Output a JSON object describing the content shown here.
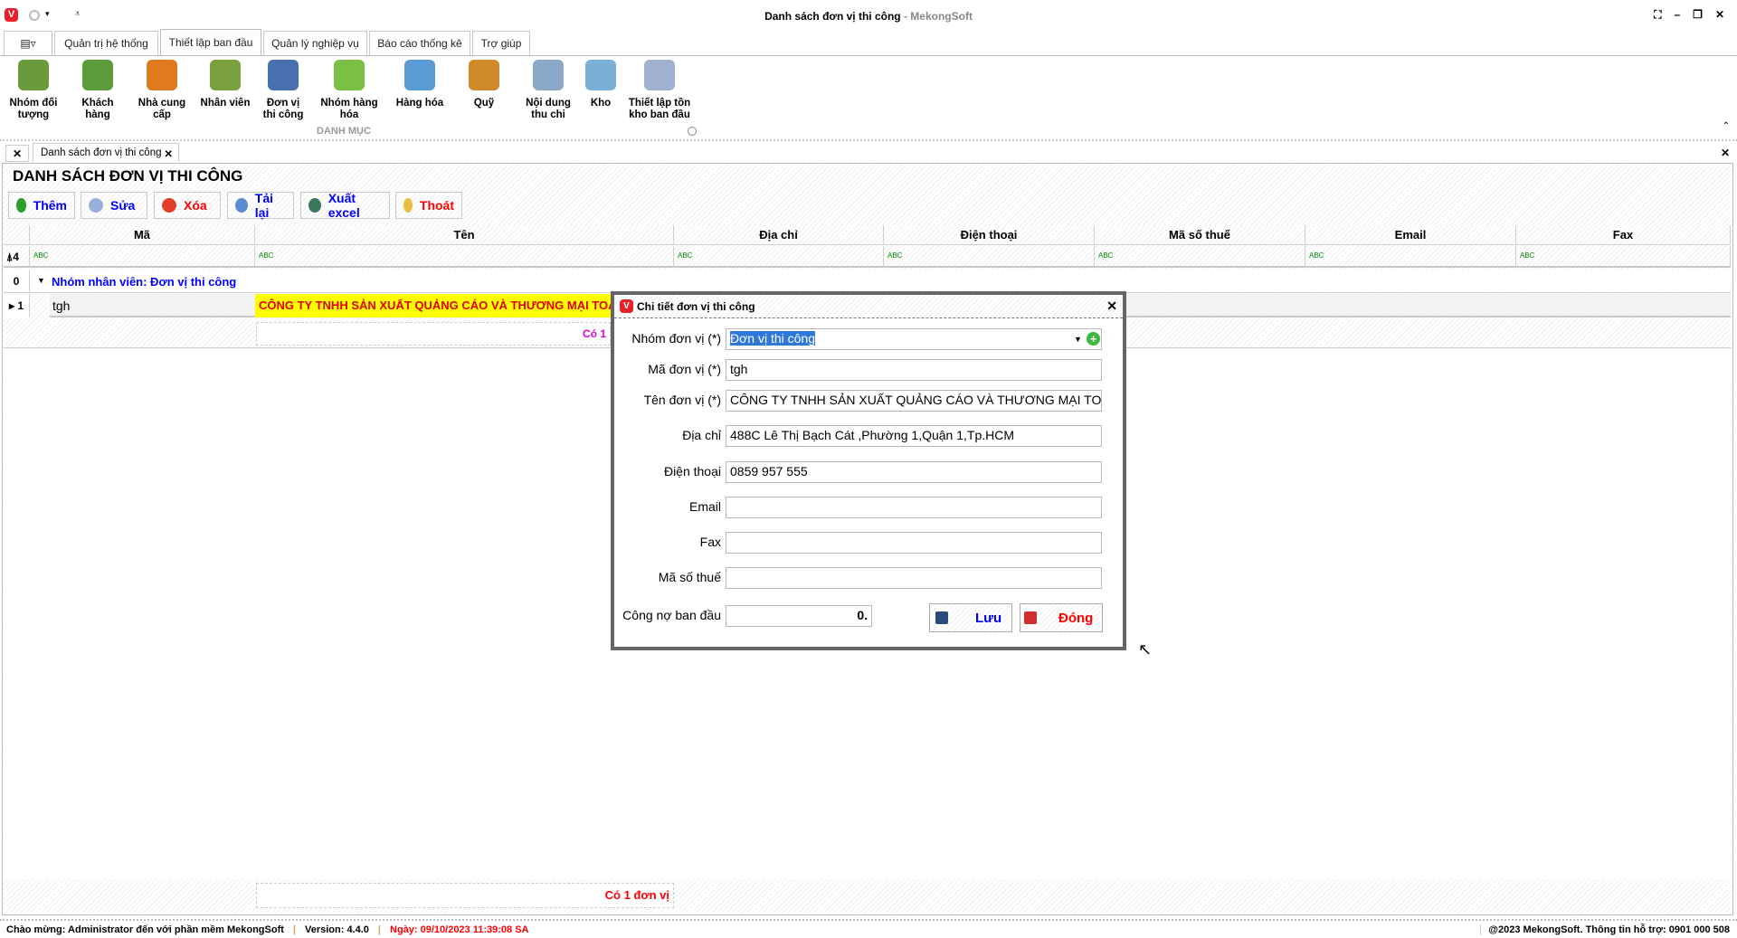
{
  "window": {
    "title": "Danh sách đơn vị thi công",
    "brand": " - MekongSoft"
  },
  "ribbon_tabs": [
    "Quản trị hệ thống",
    "Thiết lập ban đầu",
    "Quản lý nghiệp vụ",
    "Báo cáo thống kê",
    "Trợ giúp"
  ],
  "ribbon_group": "DANH MỤC",
  "ribbon_items": [
    {
      "l1": "Nhóm đối",
      "l2": "tượng",
      "c": "#6a9a3a"
    },
    {
      "l1": "Khách",
      "l2": "hàng",
      "c": "#5b9b3a"
    },
    {
      "l1": "Nhà cung",
      "l2": "cấp",
      "c": "#e07a20"
    },
    {
      "l1": "Nhân viên",
      "l2": "",
      "c": "#7aa040"
    },
    {
      "l1": "Đơn vị",
      "l2": "thi công",
      "c": "#4a6fb0"
    },
    {
      "l1": "Nhóm hàng",
      "l2": "hóa",
      "c": "#7bc043"
    },
    {
      "l1": "Hàng hóa",
      "l2": "",
      "c": "#5b9bd5"
    },
    {
      "l1": "Quỹ",
      "l2": "",
      "c": "#d08a2a"
    },
    {
      "l1": "Nội dung",
      "l2": "thu chi",
      "c": "#8aa8c8"
    },
    {
      "l1": "Kho",
      "l2": "",
      "c": "#7ab0d8"
    },
    {
      "l1": "Thiết lập tồn",
      "l2": "kho ban đầu",
      "c": "#a0b0d0"
    }
  ],
  "doc_tab": "Danh sách đơn vị thi công",
  "page_title": "DANH SÁCH ĐƠN VỊ THI CÔNG",
  "toolbar": [
    {
      "label": "Thêm",
      "color": "#0000ff",
      "icon": "#2aa02a"
    },
    {
      "label": "Sửa",
      "color": "#0000ff",
      "icon": "#9ab0d8"
    },
    {
      "label": "Xóa",
      "color": "#ff0000",
      "icon": "#e0402a"
    },
    {
      "label": "Tải lại",
      "color": "#0000ff",
      "icon": "#5b8bd0"
    },
    {
      "label": "Xuất excel",
      "color": "#0000ff",
      "icon": "#3a7a5a"
    },
    {
      "label": "Thoát",
      "color": "#ff0000",
      "icon": "#e8c040"
    }
  ],
  "grid": {
    "columns": [
      "Mã",
      "Tên",
      "Địa chỉ",
      "Điện thoại",
      "Mã số thuế",
      "Email",
      "Fax"
    ],
    "filter_row_num": "4",
    "filter_glyph": "ABC",
    "group_row_num": "0",
    "group_label": "Nhóm nhân viên: Đơn vị thi công",
    "rows": [
      {
        "num": "1",
        "ma": "tgh",
        "ten": "CÔNG TY TNHH SẢN XUẤT QUẢNG CÁO VÀ THƯƠNG MẠI TOÀN GIA"
      }
    ],
    "group_summary": "Có 1",
    "footer_summary": "Có 1 đơn vị"
  },
  "dialog": {
    "title": "Chi tiết đơn vị thi công",
    "fields": [
      {
        "label": "Nhóm đơn vị (*)",
        "value": "Đơn vị thi công"
      },
      {
        "label": "Mã đơn vị (*)",
        "value": "tgh"
      },
      {
        "label": "Tên đơn vị (*)",
        "value": "CÔNG TY TNHH SẢN XUẤT QUẢNG CÁO VÀ THƯƠNG MẠI TOÀN GIA"
      },
      {
        "label": "Địa chỉ",
        "value": "488C Lê Thị Bạch Cát ,Phường 1,Quận 1,Tp.HCM"
      },
      {
        "label": "Điện thoại",
        "value": "0859 957 555"
      },
      {
        "label": "Email",
        "value": ""
      },
      {
        "label": "Fax",
        "value": ""
      },
      {
        "label": "Mã số thuế",
        "value": ""
      },
      {
        "label": "Công nợ ban đầu",
        "value": "0."
      }
    ],
    "save": "Lưu",
    "close": "Đóng"
  },
  "status": {
    "welcome": "Chào mừng: Administrator đến với phần mềm MekongSoft",
    "version": "Version: 4.4.0",
    "date": "Ngày: 09/10/2023 11:39:08 SA",
    "copyright": "@2023 MekongSoft. Thông tin hỗ trợ: 0901 000 508"
  }
}
